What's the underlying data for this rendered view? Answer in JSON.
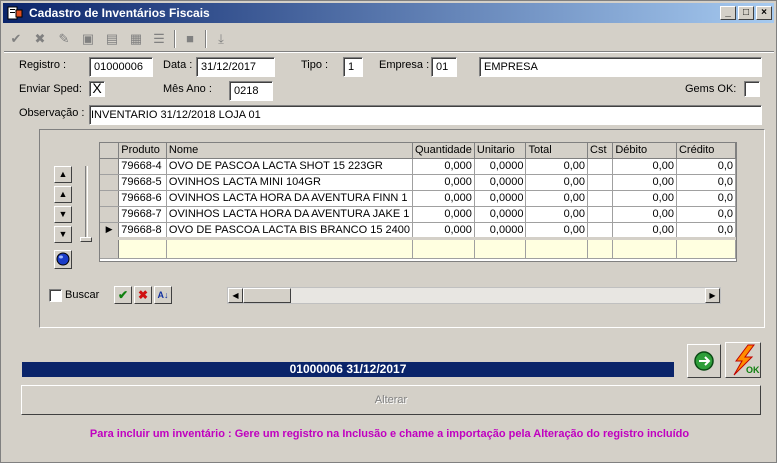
{
  "window": {
    "title": "Cadastro de Inventários Fiscais"
  },
  "form": {
    "registro_label": "Registro :",
    "registro_value": "01000006",
    "data_label": "Data :",
    "data_value": "31/12/2017",
    "tipo_label": "Tipo :",
    "tipo_value": "1",
    "empresa_label": "Empresa :",
    "empresa_code": "01",
    "empresa_name": "EMPRESA",
    "enviar_sped_label": "Enviar Sped:",
    "enviar_sped_value": "X",
    "mes_ano_label": "Mês Ano :",
    "mes_ano_value": "0218",
    "gems_ok_label": "Gems OK:",
    "observacao_label": "Observação :",
    "observacao_value": "INVENTARIO 31/12/2018 LOJA 01"
  },
  "grid": {
    "columns": [
      "Produto",
      "Nome",
      "Quantidade",
      "Unitario",
      "Total",
      "Cst",
      "Débito",
      "Crédito"
    ],
    "rows": [
      [
        "79668-4",
        "OVO DE PASCOA LACTA SHOT 15 223GR",
        "0,000",
        "0,0000",
        "0,00",
        "",
        "0,00",
        "0,0"
      ],
      [
        "79668-5",
        "OVINHOS LACTA MINI 104GR",
        "0,000",
        "0,0000",
        "0,00",
        "",
        "0,00",
        "0,0"
      ],
      [
        "79668-6",
        "OVINHOS LACTA HORA DA AVENTURA FINN 1",
        "0,000",
        "0,0000",
        "0,00",
        "",
        "0,00",
        "0,0"
      ],
      [
        "79668-7",
        "OVINHOS LACTA HORA DA AVENTURA JAKE 1",
        "0,000",
        "0,0000",
        "0,00",
        "",
        "0,00",
        "0,0"
      ],
      [
        "79668-8",
        "OVO DE PASCOA LACTA BIS BRANCO 15 2400",
        "0,000",
        "0,0000",
        "0,00",
        "",
        "0,00",
        "0,0"
      ]
    ],
    "current_row": 4
  },
  "search": {
    "buscar_label": "Buscar"
  },
  "status": {
    "text": "01000006 31/12/2017"
  },
  "buttons": {
    "alterar_label": "Alterar"
  },
  "info_message": "Para incluir um inventário : Gere um registro na Inclusão e chame a importação pela Alteração do registro incluído",
  "icons": {
    "toolbar": [
      "check-icon",
      "cancel-icon",
      "edit-icon",
      "print-icon",
      "report-icon",
      "grid-icon",
      "list-icon",
      "stop-icon",
      "export-icon"
    ],
    "nav": [
      "first-icon",
      "prior-icon",
      "next-icon",
      "last-icon",
      "globe-icon"
    ]
  },
  "colors": {
    "titlebar": "#0a246a",
    "status_bar": "#0a246a",
    "info_text": "#c000c0",
    "filter_row": "#ffffe0"
  }
}
